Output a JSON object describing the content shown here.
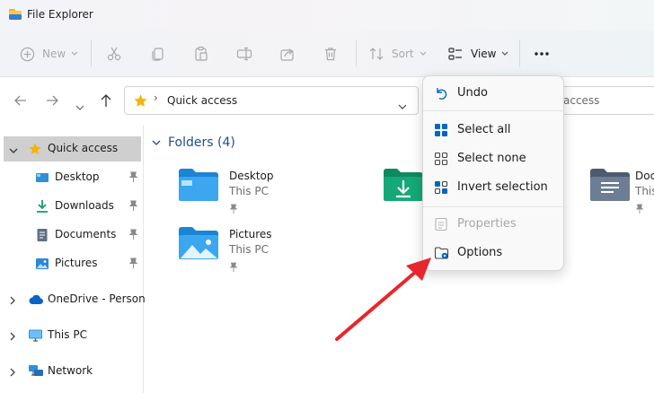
{
  "window": {
    "title": "File Explorer"
  },
  "toolbar": {
    "new_label": "New",
    "sort_label": "Sort",
    "view_label": "View",
    "more_icon": "ellipsis-icon",
    "actions": [
      "cut-icon",
      "copy-icon",
      "paste-icon",
      "rename-icon",
      "share-icon",
      "delete-icon"
    ]
  },
  "address": {
    "path": "Quick access",
    "search_text": "access"
  },
  "sidebar": {
    "quick_access": "Quick access",
    "items": [
      {
        "label": "Desktop"
      },
      {
        "label": "Downloads"
      },
      {
        "label": "Documents"
      },
      {
        "label": "Pictures"
      }
    ],
    "onedrive": "OneDrive - Personal",
    "this_pc": "This PC",
    "network": "Network"
  },
  "content": {
    "group_title": "Folders (4)",
    "folders": [
      {
        "name": "Desktop",
        "location": "This PC"
      },
      {
        "name": "Pictures",
        "location": "This PC"
      },
      {
        "name": "Doc",
        "location": "This"
      }
    ]
  },
  "context_menu": {
    "undo": "Undo",
    "select_all": "Select all",
    "select_none": "Select none",
    "invert_selection": "Invert selection",
    "properties": "Properties",
    "options": "Options"
  },
  "colors": {
    "accent": "#0067c0",
    "annotation_arrow": "#e8262d",
    "star": "#f5b400",
    "group_header": "#1f4e8c"
  }
}
